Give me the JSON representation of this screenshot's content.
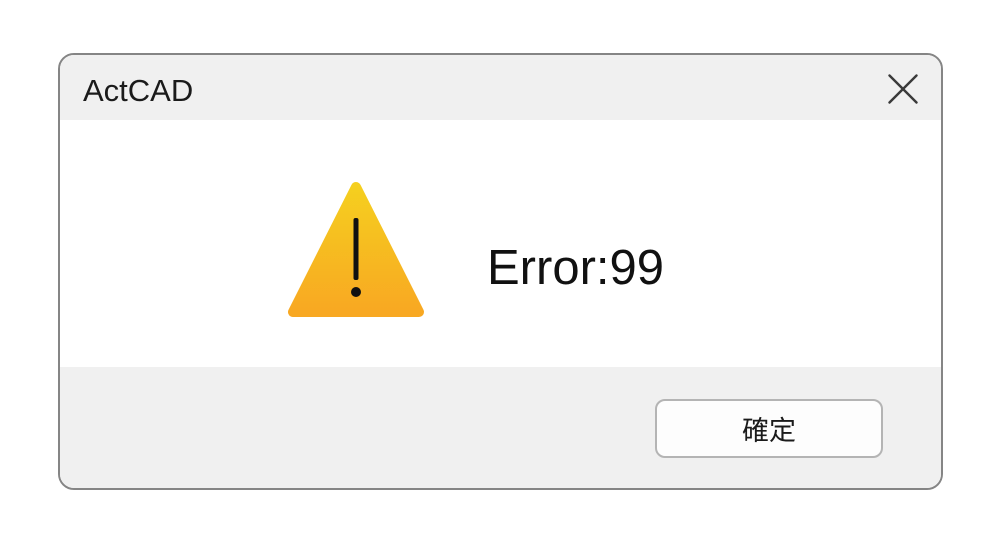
{
  "window": {
    "title": "ActCAD",
    "close_icon": "close-icon"
  },
  "message": {
    "icon": "warning-icon",
    "text": "Error:99"
  },
  "footer": {
    "ok_label": "確定"
  },
  "colors": {
    "warning_top": "#f5cf1f",
    "warning_bottom": "#f8a822",
    "chrome_bg": "#f0f0f0",
    "window_border": "#858585"
  }
}
